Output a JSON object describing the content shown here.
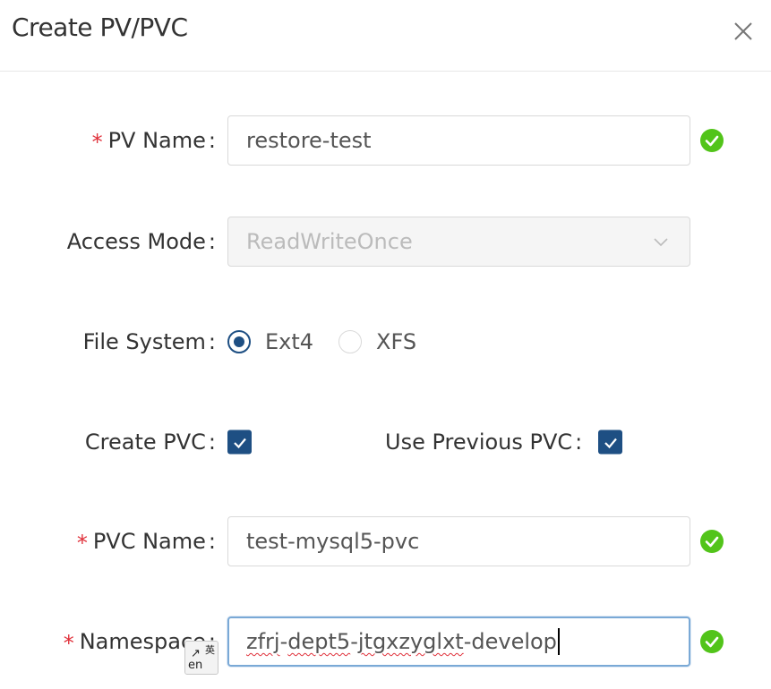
{
  "dialog": {
    "title": "Create PV/PVC",
    "close_label": "X"
  },
  "form": {
    "pv_name": {
      "label": "PV Name",
      "required": true,
      "value": "restore-test",
      "valid": true
    },
    "access_mode": {
      "label": "Access Mode",
      "value": "ReadWriteOnce",
      "disabled": true
    },
    "file_system": {
      "label": "File System",
      "options": [
        {
          "label": "Ext4",
          "checked": true
        },
        {
          "label": "XFS",
          "checked": false
        }
      ]
    },
    "create_pvc": {
      "label": "Create PVC",
      "checked": true
    },
    "use_previous_pvc": {
      "label": "Use Previous PVC",
      "checked": true
    },
    "pvc_name": {
      "label": "PVC Name",
      "required": true,
      "value": "test-mysql5-pvc",
      "valid": true
    },
    "namespace": {
      "label": "Namespace",
      "required": true,
      "value_part1": "zfrj",
      "value_sep1": "-",
      "value_part2": "dept5",
      "value_sep2": "-",
      "value_part3": "jtgxzyglxt",
      "value_part4": "-develop",
      "valid": true
    },
    "colon": ":"
  },
  "ime": {
    "zh": "英",
    "en": "en",
    "arrow": "↗"
  },
  "colors": {
    "primary": "#1e4f83",
    "success": "#52c41a",
    "required": "#e0303a",
    "border": "#d9d9d9"
  }
}
